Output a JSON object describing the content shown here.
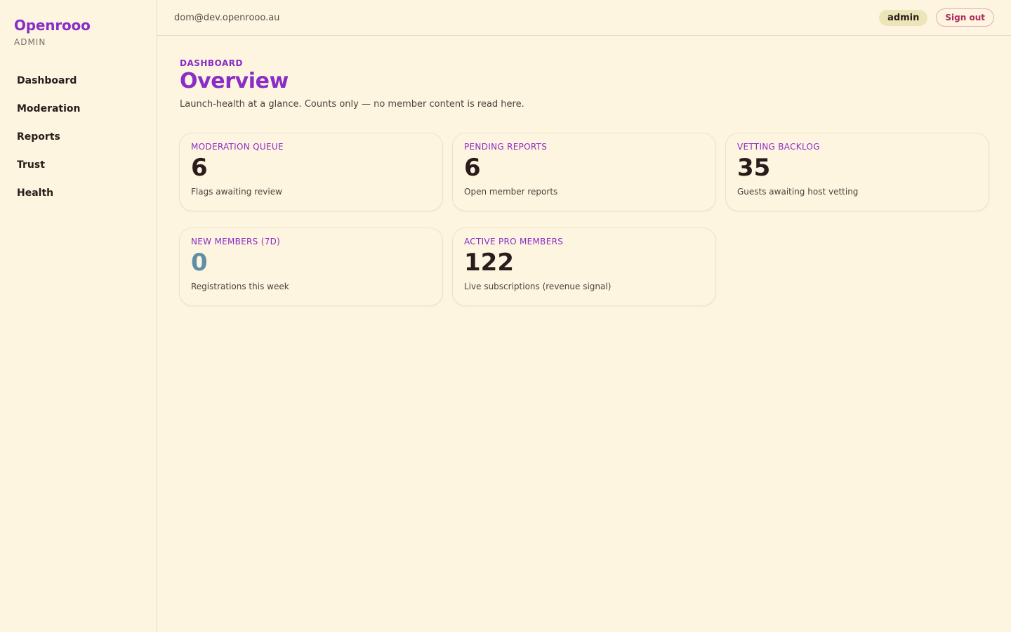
{
  "brand": {
    "name": "Openrooo",
    "subtitle": "ADMIN"
  },
  "nav": {
    "items": [
      {
        "label": "Dashboard"
      },
      {
        "label": "Moderation"
      },
      {
        "label": "Reports"
      },
      {
        "label": "Trust"
      },
      {
        "label": "Health"
      }
    ]
  },
  "header": {
    "email": "dom@dev.openrooo.au",
    "role": "admin",
    "signout_label": "Sign out"
  },
  "page": {
    "eyebrow": "DASHBOARD",
    "title": "Overview",
    "subtitle": "Launch-health at a glance. Counts only — no member content is read here."
  },
  "stats": [
    {
      "label": "MODERATION QUEUE",
      "value": "6",
      "desc": "Flags awaiting review"
    },
    {
      "label": "PENDING REPORTS",
      "value": "6",
      "desc": "Open member reports"
    },
    {
      "label": "VETTING BACKLOG",
      "value": "35",
      "desc": "Guests awaiting host vetting"
    },
    {
      "label": "NEW MEMBERS (7D)",
      "value": "0",
      "desc": "Registrations this week"
    },
    {
      "label": "ACTIVE PRO MEMBERS",
      "value": "122",
      "desc": "Live subscriptions (revenue signal)"
    }
  ],
  "colors": {
    "background": "#fdf5e0",
    "accent": "#8a2cc6",
    "zero_value": "#5f8fa5",
    "signout": "#b02a5a",
    "role_badge": "#ece5b7"
  }
}
